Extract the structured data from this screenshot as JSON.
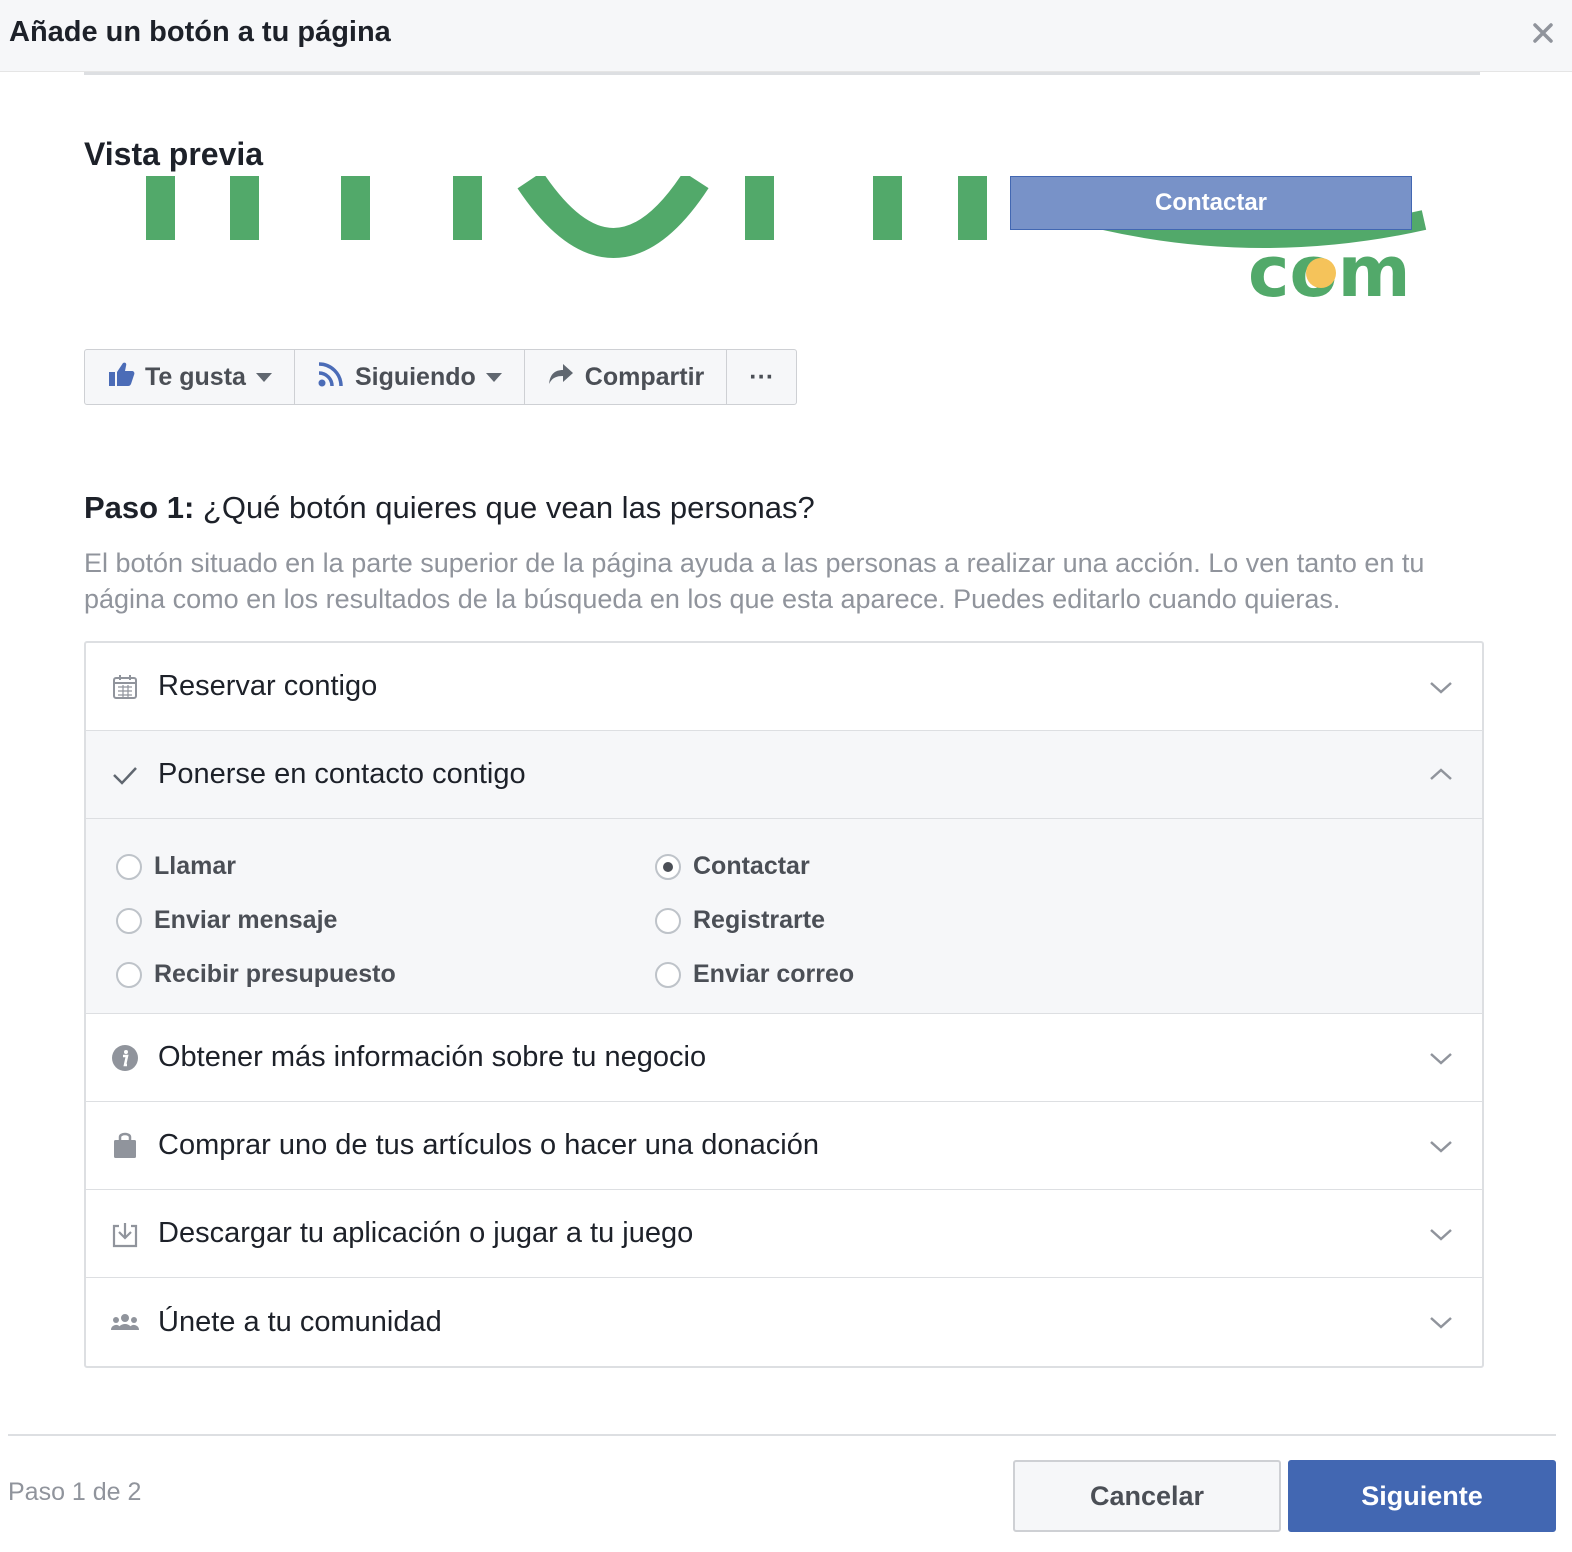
{
  "dialog": {
    "title": "Añade un botón a tu página",
    "close_icon": "close-icon"
  },
  "preview": {
    "label": "Vista previa",
    "cta_label": "Contactar",
    "logo_text": "com"
  },
  "page_actions": [
    {
      "label": "Te gusta",
      "icon": "thumbs-up-icon"
    },
    {
      "label": "Siguiendo",
      "icon": "rss-icon"
    },
    {
      "label": "Compartir",
      "icon": "share-arrow-icon"
    },
    {
      "label": "···",
      "icon": "more-icon"
    }
  ],
  "step": {
    "prefix": "Paso 1:",
    "question": " ¿Qué botón quieres que vean las personas?",
    "description": "El botón situado en la parte superior de la página ayuda a las personas a realizar una acción. Lo ven tanto en tu página como en los resultados de la búsqueda en los que esta aparece. Puedes editarlo cuando quieras."
  },
  "options": [
    {
      "label": "Reservar contigo",
      "icon": "calendar-icon",
      "expanded": false
    },
    {
      "label": "Ponerse en contacto contigo",
      "icon": "checkmark-icon",
      "expanded": true
    },
    {
      "label": "Obtener más información sobre tu negocio",
      "icon": "info-icon",
      "expanded": false
    },
    {
      "label": "Comprar uno de tus artículos o hacer una donación",
      "icon": "shopping-bag-icon",
      "expanded": false
    },
    {
      "label": "Descargar tu aplicación o jugar a tu juego",
      "icon": "download-icon",
      "expanded": false
    },
    {
      "label": "Únete a tu comunidad",
      "icon": "group-icon",
      "expanded": false
    }
  ],
  "contact_choices": [
    {
      "label": "Llamar",
      "checked": false
    },
    {
      "label": "Enviar mensaje",
      "checked": false
    },
    {
      "label": "Recibir presupuesto",
      "checked": false
    },
    {
      "label": "Contactar",
      "checked": true
    },
    {
      "label": "Registrarte",
      "checked": false
    },
    {
      "label": "Enviar correo",
      "checked": false
    }
  ],
  "footer": {
    "step_count": "Paso 1 de 2",
    "cancel_label": "Cancelar",
    "next_label": "Siguiente"
  },
  "colors": {
    "primary": "#4267b2",
    "preview_button": "#7892c8",
    "logo_green": "#52a96a",
    "logo_dot": "#f5c35a",
    "header_bg": "#f6f7f9"
  }
}
